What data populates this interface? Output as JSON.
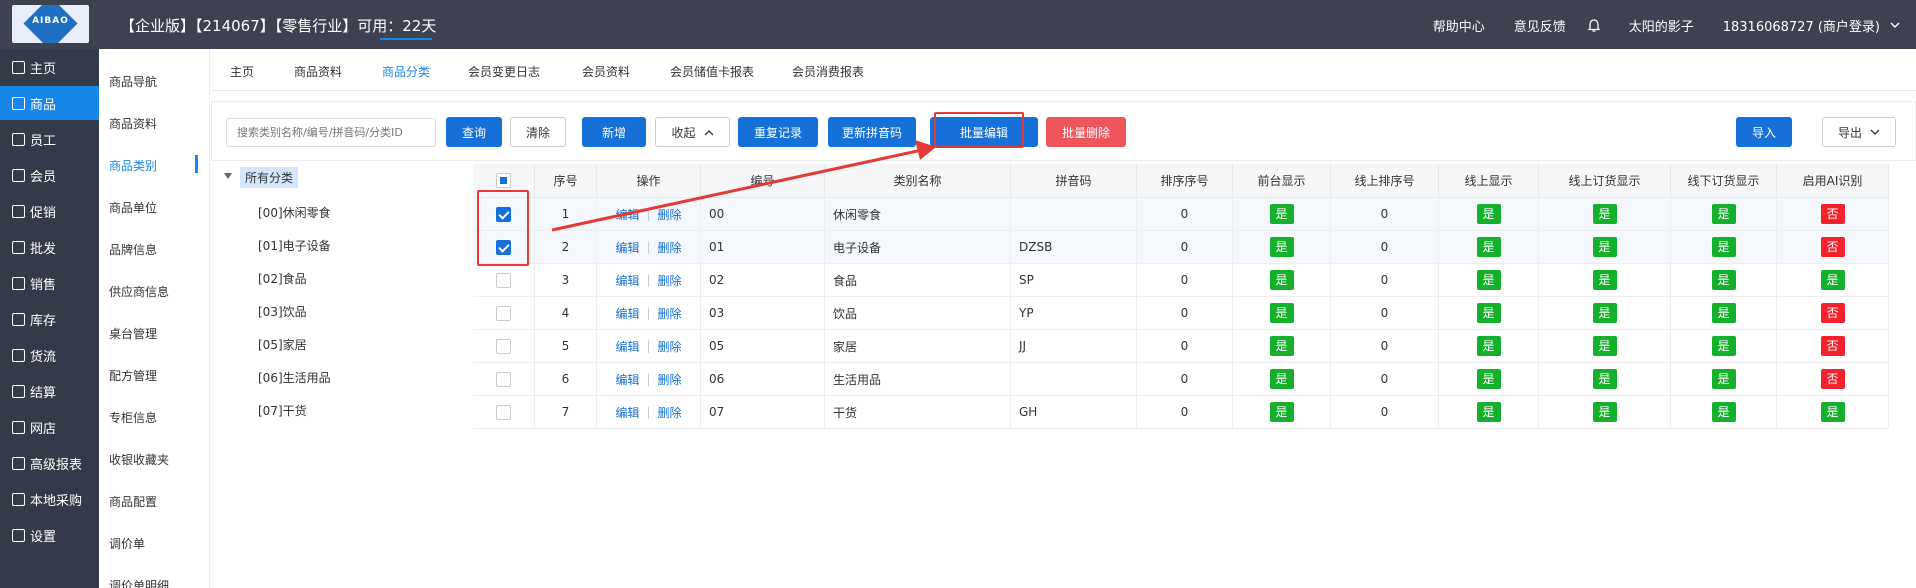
{
  "header": {
    "title": "【企业版】【214067】【零售行业】可用：22天",
    "help": "帮助中心",
    "feedback": "意见反馈",
    "user": "太阳的影子",
    "account": "18316068727 (商户登录)",
    "logo": "AIBAO"
  },
  "sidebar": {
    "items": [
      "主页",
      "商品",
      "员工",
      "会员",
      "促销",
      "批发",
      "销售",
      "库存",
      "货流",
      "结算",
      "网店",
      "高级报表",
      "本地采购",
      "设置"
    ],
    "active": 1
  },
  "subnav": {
    "items": [
      "商品导航",
      "商品资料",
      "商品类别",
      "商品单位",
      "品牌信息",
      "供应商信息",
      "桌台管理",
      "配方管理",
      "专柜信息",
      "收银收藏夹",
      "商品配置",
      "调价单",
      "调价单明细"
    ],
    "active": 2
  },
  "tabs": {
    "items": [
      "主页",
      "商品资料",
      "商品分类",
      "会员变更日志",
      "会员资料",
      "会员储值卡报表",
      "会员消费报表"
    ],
    "active": 2
  },
  "toolbar": {
    "search_placeholder": "搜索类别名称/编号/拼音码/分类ID",
    "query": "查询",
    "clear": "清除",
    "add": "新增",
    "collapse": "收起",
    "reset": "重复记录",
    "update_pinyin": "更新拼音码",
    "batch_edit": "批量编辑",
    "batch_delete": "批量删除",
    "import": "导入",
    "export": "导出"
  },
  "tree": {
    "root": "所有分类",
    "nodes": [
      "[00]休闲零食",
      "[01]电子设备",
      "[02]食品",
      "[03]饮品",
      "[05]家居",
      "[06]生活用品",
      "[07]干货"
    ]
  },
  "table": {
    "headers": [
      "序号",
      "操作",
      "编号",
      "类别名称",
      "拼音码",
      "排序序号",
      "前台显示",
      "线上排序号",
      "线上显示",
      "线上订货显示",
      "线下订货显示",
      "启用AI识别"
    ],
    "edit": "编辑",
    "delete": "删除",
    "yes": "是",
    "no": "否",
    "rows": [
      {
        "checked": true,
        "seq": "1",
        "code": "00",
        "name": "休闲零食",
        "pinyin": "",
        "sort": "0",
        "front": "是",
        "online_sort": "0",
        "online": "是",
        "online_order": "是",
        "offline_order": "是",
        "ai": "否"
      },
      {
        "checked": true,
        "seq": "2",
        "code": "01",
        "name": "电子设备",
        "pinyin": "DZSB",
        "sort": "0",
        "front": "是",
        "online_sort": "0",
        "online": "是",
        "online_order": "是",
        "offline_order": "是",
        "ai": "否"
      },
      {
        "checked": false,
        "seq": "3",
        "code": "02",
        "name": "食品",
        "pinyin": "SP",
        "sort": "0",
        "front": "是",
        "online_sort": "0",
        "online": "是",
        "online_order": "是",
        "offline_order": "是",
        "ai": "是"
      },
      {
        "checked": false,
        "seq": "4",
        "code": "03",
        "name": "饮品",
        "pinyin": "YP",
        "sort": "0",
        "front": "是",
        "online_sort": "0",
        "online": "是",
        "online_order": "是",
        "offline_order": "是",
        "ai": "否"
      },
      {
        "checked": false,
        "seq": "5",
        "code": "05",
        "name": "家居",
        "pinyin": "JJ",
        "sort": "0",
        "front": "是",
        "online_sort": "0",
        "online": "是",
        "online_order": "是",
        "offline_order": "是",
        "ai": "否"
      },
      {
        "checked": false,
        "seq": "6",
        "code": "06",
        "name": "生活用品",
        "pinyin": "",
        "sort": "0",
        "front": "是",
        "online_sort": "0",
        "online": "是",
        "online_order": "是",
        "offline_order": "是",
        "ai": "否"
      },
      {
        "checked": false,
        "seq": "7",
        "code": "07",
        "name": "干货",
        "pinyin": "GH",
        "sort": "0",
        "front": "是",
        "online_sort": "0",
        "online": "是",
        "online_order": "是",
        "offline_order": "是",
        "ai": "是"
      }
    ]
  },
  "colors": {
    "accent": "#1570d8",
    "topbar": "#3d4150",
    "sidebar": "#353a48",
    "yes": "#15b02c",
    "no": "#f5222d",
    "annotation": "#e53935"
  }
}
